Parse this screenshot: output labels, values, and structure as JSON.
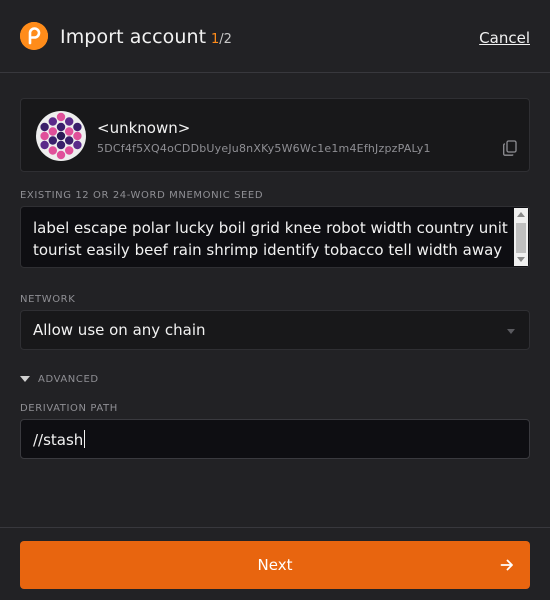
{
  "header": {
    "title": "Import account",
    "step_current": "1",
    "step_total": "/2",
    "cancel_label": "Cancel",
    "logo_icon": "polkadot-logo-icon",
    "accent_color": "#ff8c1a"
  },
  "account": {
    "name": "<unknown>",
    "address": "5DCf4f5XQ4oCDDbUyeJu8nXKy5W6Wc1e1m4EfhJzpzPALy1",
    "copy_icon": "copy-icon"
  },
  "seed": {
    "label": "EXISTING 12 OR 24-WORD MNEMONIC SEED",
    "value": "label escape polar lucky boil grid knee robot width country unit tourist easily beef rain shrimp identify tobacco tell width away"
  },
  "network": {
    "label": "NETWORK",
    "selected": "Allow use on any chain"
  },
  "advanced": {
    "label": "ADVANCED",
    "expanded": true
  },
  "derivation": {
    "label": "DERIVATION PATH",
    "value": "//stash"
  },
  "footer": {
    "next_label": "Next",
    "button_color": "#e8650f",
    "arrow_icon": "arrow-right-icon"
  }
}
